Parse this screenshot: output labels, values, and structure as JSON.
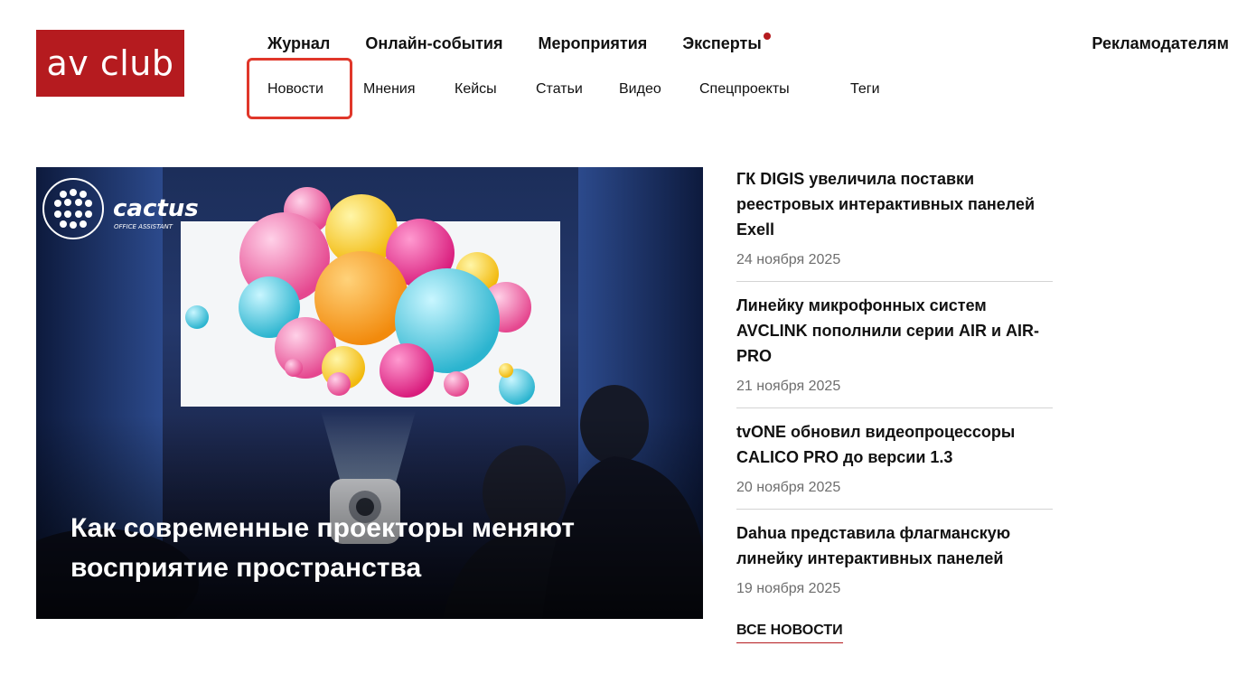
{
  "logo": {
    "text": "av club",
    "color": "#b51b1f"
  },
  "nav": {
    "main": [
      "Журнал",
      "Онлайн-события",
      "Мероприятия",
      "Эксперты"
    ],
    "advertisers": "Рекламодателям",
    "sub": [
      "Новости",
      "Мнения",
      "Кейсы",
      "Статьи",
      "Видео",
      "Спецпроекты",
      "Теги"
    ]
  },
  "hero": {
    "title": "Как современные проекторы меняют восприятие пространства",
    "brand": "cactus",
    "brand_sub": "OFFICE ASSISTANT"
  },
  "news": [
    {
      "title": "ГК DIGIS увеличила поставки реестровых интерактивных панелей Exell",
      "date": "24 ноября 2025"
    },
    {
      "title": "Линейку микрофонных систем AVCLINK пополнили серии AIR и AIR-PRO",
      "date": "21 ноября 2025"
    },
    {
      "title": "tvONE обновил видеопроцессоры CALICO PRO до версии 1.3",
      "date": "20 ноября 2025"
    },
    {
      "title": "Dahua представила флагманскую линейку интерактивных панелей",
      "date": "19 ноября 2025"
    }
  ],
  "all_news": "ВСЕ НОВОСТИ",
  "colors": {
    "accent": "#b51b1f",
    "highlight": "#e0372a"
  }
}
